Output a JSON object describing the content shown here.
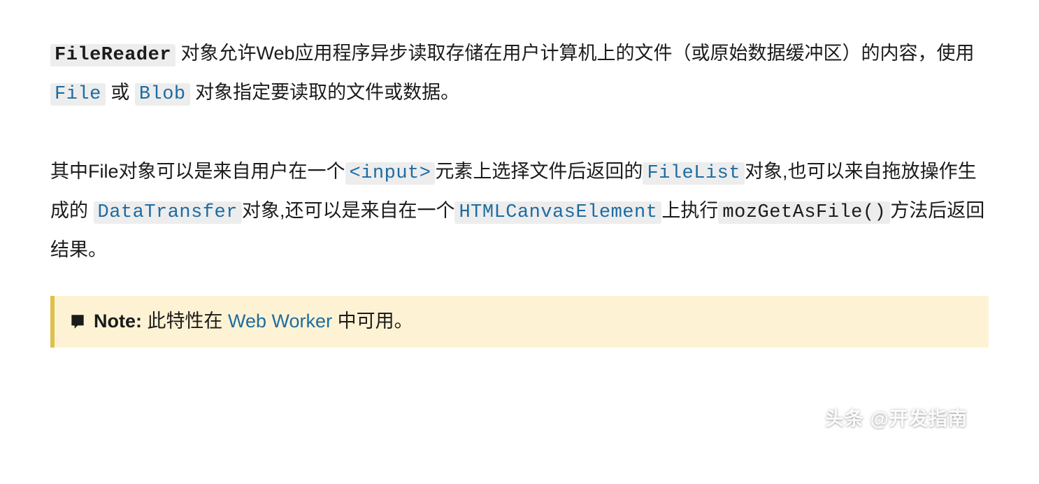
{
  "para1": {
    "code1": "FileReader",
    "t1": " 对象允许Web应用程序异步读取存储在用户计算机上的文件（或原始数据缓冲区）的内容，使用 ",
    "link1": "File",
    "t2": " 或 ",
    "link2": "Blob",
    "t3": " 对象指定要读取的文件或数据。"
  },
  "para2": {
    "t1": "其中File对象可以是来自用户在一个",
    "link1": "<input>",
    "t2": "元素上选择文件后返回的",
    "link2": "FileList",
    "t3": "对象,也可以来自拖放操作生成的 ",
    "link3": "DataTransfer",
    "t4": "对象,还可以是来自在一个",
    "link4": "HTMLCanvasElement",
    "t5": "上执行",
    "code1": "mozGetAsFile()",
    "t6": "方法后返回结果。"
  },
  "note": {
    "label": "Note:",
    "t1": " 此特性在 ",
    "link1": "Web Worker",
    "t2": " 中可用。"
  },
  "watermark": "头条 @开发指南"
}
